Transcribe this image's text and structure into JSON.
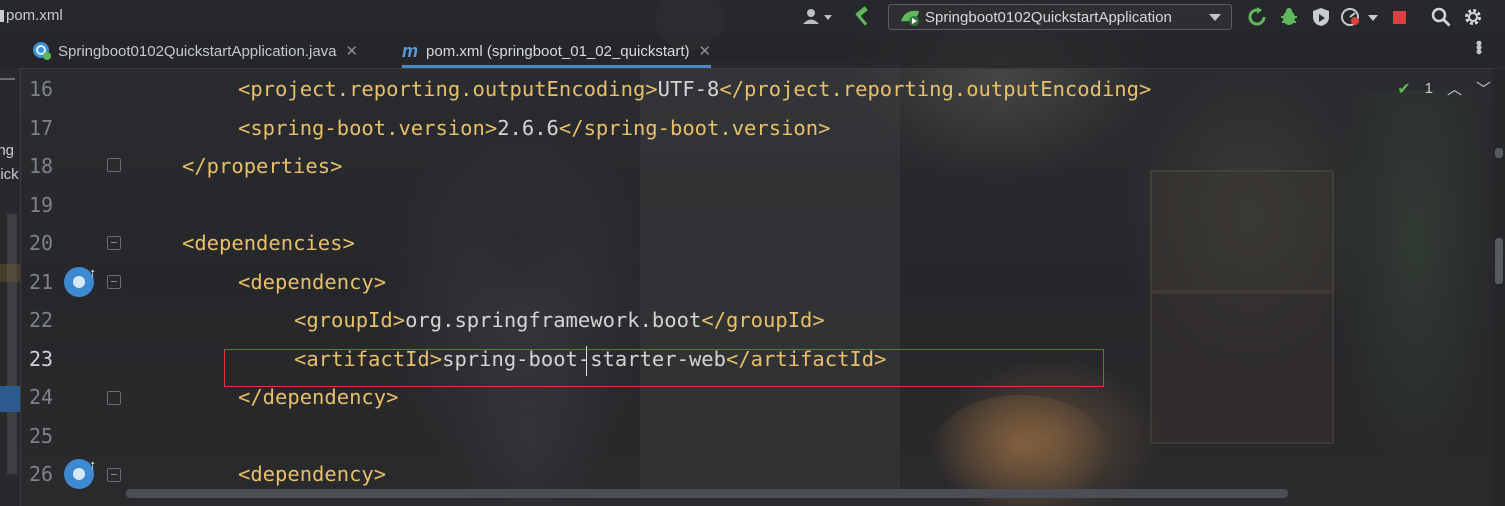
{
  "window": {
    "title": "pom.xml"
  },
  "toolbar": {
    "run_config": "Springboot0102QuickstartApplication",
    "icons": [
      "user-icon",
      "build-hammer-icon",
      "rerun-icon",
      "debug-icon",
      "coverage-icon",
      "profile-icon",
      "stop-icon",
      "search-icon",
      "settings-icon"
    ],
    "colors": {
      "build": "#5fb85a",
      "rerun": "#5fb85a",
      "debug": "#5fb85a",
      "stop": "#d94040"
    }
  },
  "tabs": [
    {
      "label": "Springboot0102QuickstartApplication.java",
      "active": false,
      "icon": "spring-java-class-icon"
    },
    {
      "label": "pom.xml (springboot_01_02_quickstart)",
      "active": true,
      "icon": "maven-m-icon"
    }
  ],
  "sidebar": {
    "fragment_1": "ing",
    "fragment_2": "uick"
  },
  "inspection": {
    "count": "1"
  },
  "editor": {
    "current_line": "23",
    "highlighted_line": "23",
    "lines": [
      {
        "number": "16",
        "tag_open": "<project.reporting.outputEncoding>",
        "text": "UTF-8",
        "tag_close": "</project.reporting.outputEncoding>"
      },
      {
        "number": "17",
        "tag_open": "<spring-boot.version>",
        "text": "2.6.6",
        "tag_close": "</spring-boot.version>"
      },
      {
        "number": "18",
        "tag_open": "</properties>",
        "text": "",
        "tag_close": ""
      },
      {
        "number": "19",
        "tag_open": "",
        "text": "",
        "tag_close": ""
      },
      {
        "number": "20",
        "tag_open": "<dependencies>",
        "text": "",
        "tag_close": ""
      },
      {
        "number": "21",
        "tag_open": "<dependency>",
        "text": "",
        "tag_close": ""
      },
      {
        "number": "22",
        "tag_open": "<groupId>",
        "text": "org.springframework.boot",
        "tag_close": "</groupId>"
      },
      {
        "number": "23",
        "tag_open": "<artifactId>",
        "text": "spring-boot-starter-web",
        "tag_close": "</artifactId>"
      },
      {
        "number": "24",
        "tag_open": "</dependency>",
        "text": "",
        "tag_close": ""
      },
      {
        "number": "25",
        "tag_open": "",
        "text": "",
        "tag_close": ""
      },
      {
        "number": "26",
        "tag_open": "<dependency>",
        "text": "",
        "tag_close": ""
      }
    ],
    "colors": {
      "tag": "#e8bf6a",
      "text": "#d4d4d4",
      "highlight_border": "#d9393b"
    }
  }
}
